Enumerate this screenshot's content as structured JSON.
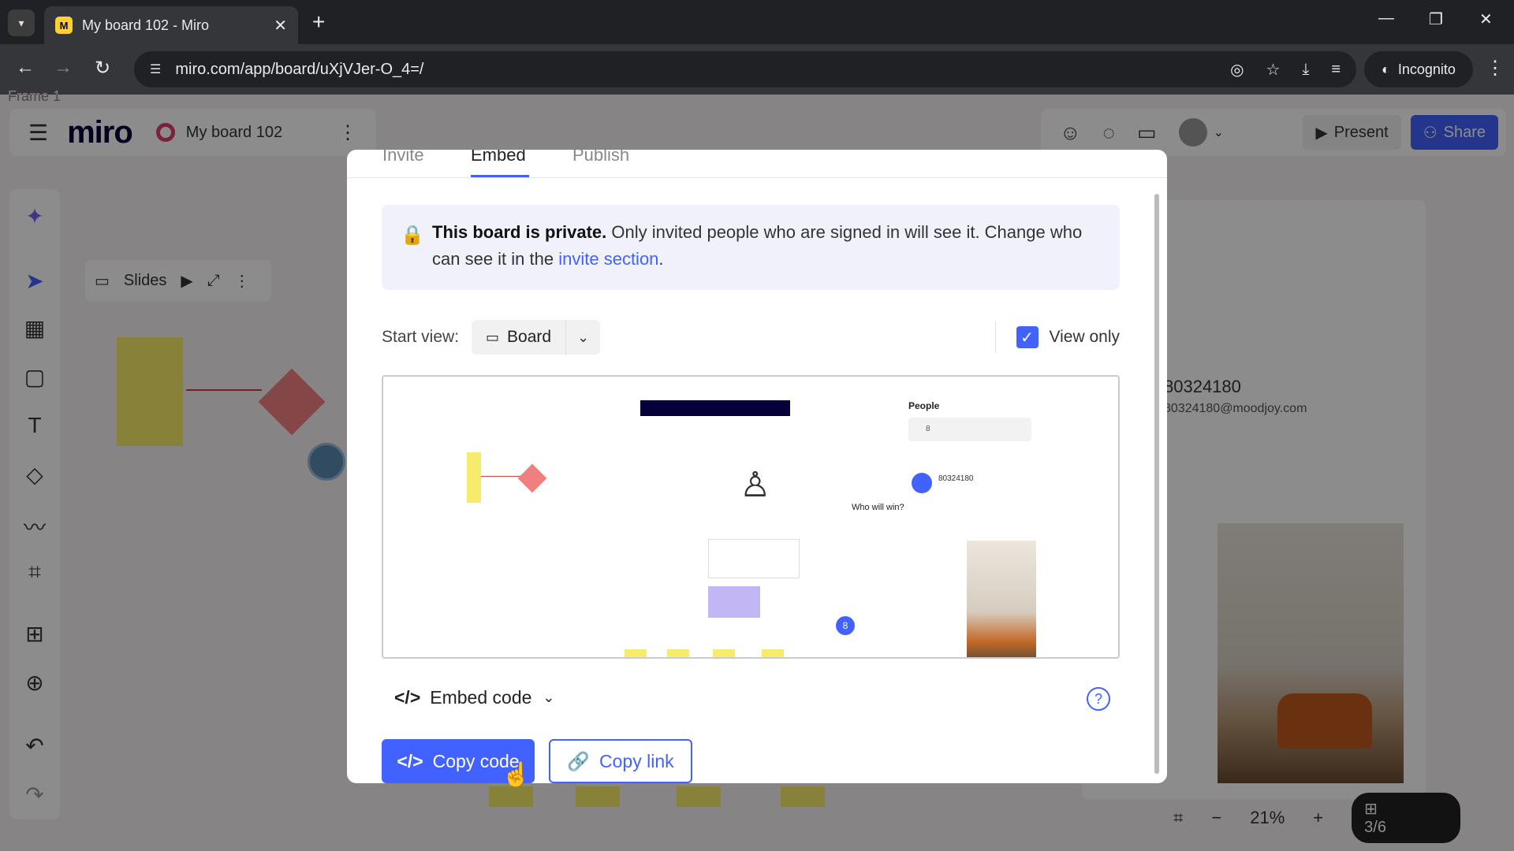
{
  "browser": {
    "tab_title": "My board 102 - Miro",
    "url": "miro.com/app/board/uXjVJer-O_4=/",
    "incognito_label": "Incognito"
  },
  "board": {
    "frame_label": "Frame 1",
    "logo": "miro",
    "name": "My board 102",
    "present_label": "Present",
    "share_label": "Share",
    "slides_label": "Slides",
    "user_id": "80324180",
    "user_email": "80324180@moodjoy.com",
    "zoom": "21%",
    "pages": "3/6"
  },
  "modal": {
    "tabs": [
      "Invite",
      "Embed",
      "Publish"
    ],
    "active_tab": "Embed",
    "notice_bold": "This board is private.",
    "notice_text": "Only invited people who are signed in will see it. Change who can see it in the",
    "notice_link": "invite section",
    "notice_end": ".",
    "start_view_label": "Start view:",
    "start_view_value": "Board",
    "view_only_label": "View only",
    "view_only_checked": true,
    "preview": {
      "people_title": "People",
      "people_search": "8",
      "result_id": "80324180",
      "poll_label": "Who will win?",
      "badge": "8"
    },
    "embed_code_label": "Embed code",
    "copy_code_label": "Copy code",
    "copy_link_label": "Copy link"
  },
  "colors": {
    "accent": "#4262ff",
    "miro_yellow": "#ffd02f",
    "sticky_yellow": "#f7ec6a"
  }
}
